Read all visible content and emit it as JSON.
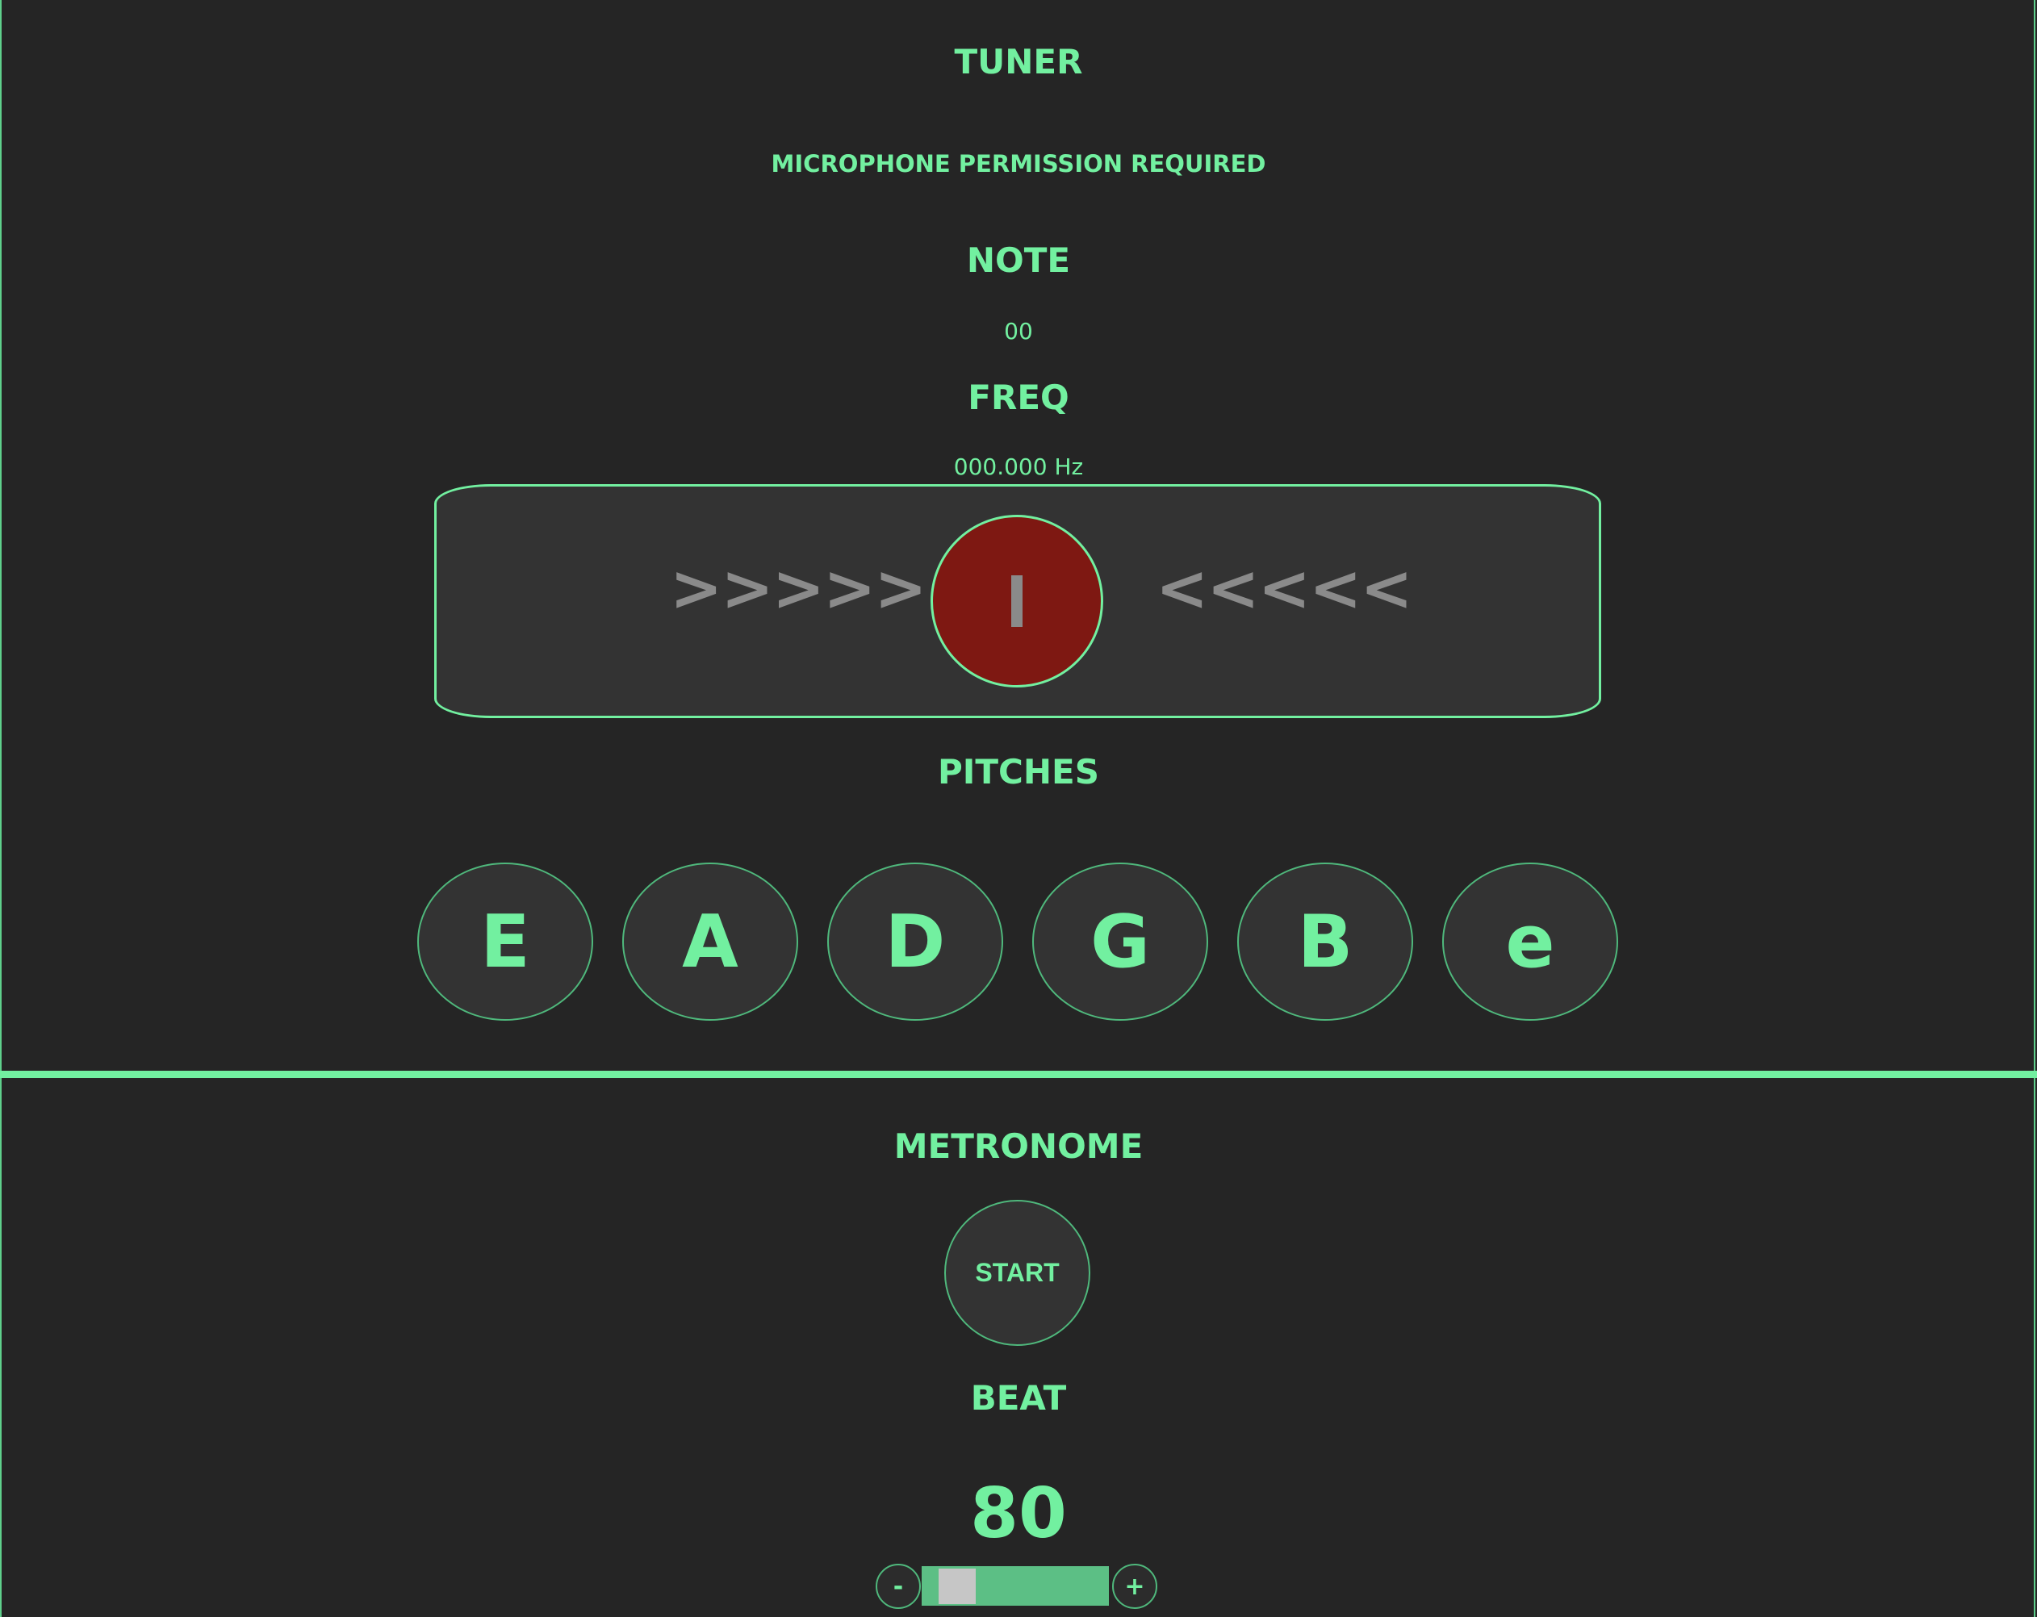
{
  "tuner": {
    "title": "TUNER",
    "permission_notice": "MICROPHONE PERMISSION REQUIRED",
    "note_label": "NOTE",
    "note_value": "00",
    "freq_label": "FREQ",
    "freq_value": "000.000 Hz",
    "arrows_left": ">>>>>",
    "arrows_right": "<<<<<",
    "needle_color": "#7e1812"
  },
  "pitches": {
    "label": "PITCHES",
    "strings": [
      "E",
      "A",
      "D",
      "G",
      "B",
      "e"
    ]
  },
  "metronome": {
    "title": "METRONOME",
    "start_label": "START",
    "beat_label": "BEAT",
    "bpm": "80",
    "decrement_label": "-",
    "increment_label": "+"
  },
  "colors": {
    "accent": "#72f0a0",
    "background": "#252525",
    "panel": "#333333"
  }
}
